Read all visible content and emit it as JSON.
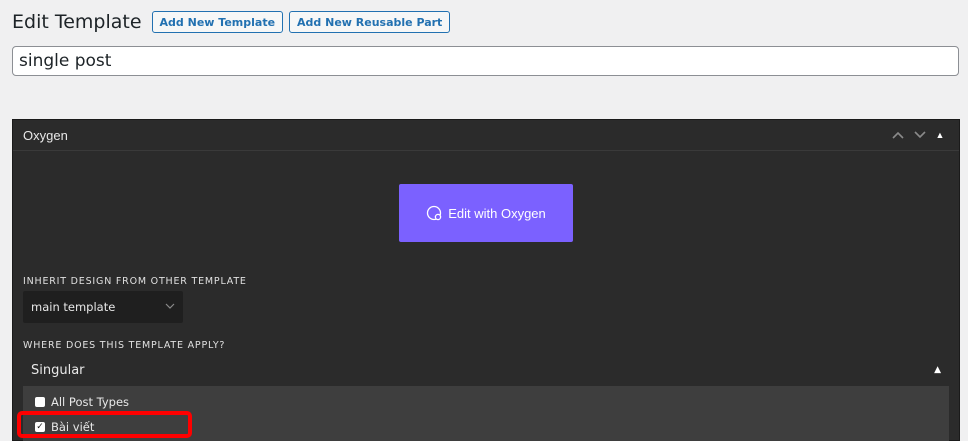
{
  "page": {
    "title": "Edit Template",
    "add_template_label": "Add New Template",
    "add_reusable_label": "Add New Reusable Part"
  },
  "title_input": {
    "value": "single post"
  },
  "metabox": {
    "title": "Oxygen",
    "edit_button_label": "Edit with Oxygen",
    "inherit_label": "INHERIT DESIGN FROM OTHER TEMPLATE",
    "inherit_value": "main template",
    "apply_label": "WHERE DOES THIS TEMPLATE APPLY?",
    "section_title": "Singular",
    "options": [
      {
        "label": "All Post Types",
        "checked": false
      },
      {
        "label": "Bài viết",
        "checked": true
      }
    ]
  },
  "colors": {
    "oxygen_purple": "#7b61ff",
    "wp_blue": "#2271b1",
    "highlight_red": "#ff0000"
  }
}
